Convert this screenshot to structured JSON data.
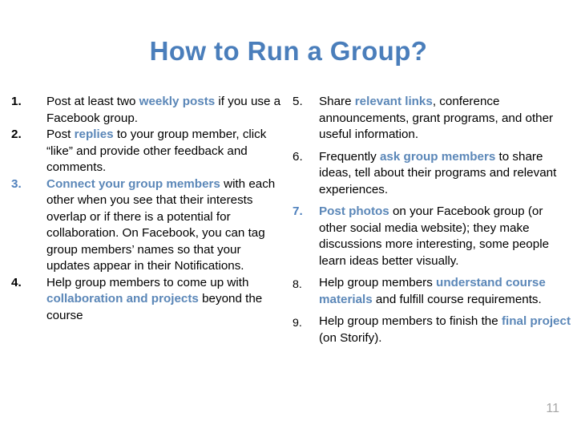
{
  "slide": {
    "title": "How to Run a Group?",
    "page_number": "11",
    "title_color": "#4a7ebb",
    "accent_color": "#5b87b8",
    "number_accent_color": "#4f81bd",
    "body_color": "#000000",
    "page_number_color": "#a6a6a6",
    "background_color": "#ffffff"
  },
  "columns": {
    "left": [
      {
        "number": "1.",
        "number_accent": false,
        "segments": [
          {
            "text": "Post at least two ",
            "highlight": false
          },
          {
            "text": "weekly posts",
            "highlight": true
          },
          {
            "text": " if you use a Facebook group.",
            "highlight": false
          }
        ]
      },
      {
        "number": "2.",
        "number_accent": false,
        "segments": [
          {
            "text": "Post ",
            "highlight": false
          },
          {
            "text": "replies",
            "highlight": true
          },
          {
            "text": " to your group member, click “like” and provide other feedback and comments.",
            "highlight": false
          }
        ]
      },
      {
        "number": "3.",
        "number_accent": true,
        "segments": [
          {
            "text": "Connect your group members",
            "highlight": true
          },
          {
            "text": " with each other when you see that their interests overlap or if there is a potential for collaboration. On Facebook, you can tag group members’ names so that your updates appear in their Notifications.",
            "highlight": false
          }
        ]
      },
      {
        "number": "4.",
        "number_accent": false,
        "segments": [
          {
            "text": "Help group members to come up with ",
            "highlight": false
          },
          {
            "text": "collaboration and projects",
            "highlight": true
          },
          {
            "text": " beyond the course",
            "highlight": false
          }
        ]
      }
    ],
    "right": [
      {
        "number": "5.",
        "number_accent": false,
        "number_shift": false,
        "segments": [
          {
            "text": "Share ",
            "highlight": false
          },
          {
            "text": "relevant links",
            "highlight": true
          },
          {
            "text": ", conference announcements, grant programs, and other useful information.",
            "highlight": false
          }
        ]
      },
      {
        "number": "6.",
        "number_accent": false,
        "number_shift": false,
        "segments": [
          {
            "text": "Frequently ",
            "highlight": false
          },
          {
            "text": "ask group members",
            "highlight": true
          },
          {
            "text": " to share ideas, tell about their programs and relevant experiences.",
            "highlight": false
          }
        ]
      },
      {
        "number": "7.",
        "number_accent": true,
        "number_shift": false,
        "segments": [
          {
            "text": "Post photos",
            "highlight": true
          },
          {
            "text": " on your Facebook group (or other social media website); they make discussions more interesting, some people learn ideas better visually.",
            "highlight": false
          }
        ]
      },
      {
        "number": "8.",
        "number_accent": false,
        "number_shift": true,
        "segments": [
          {
            "text": "Help group members ",
            "highlight": false
          },
          {
            "text": "understand course materials",
            "highlight": true
          },
          {
            "text": " and fulfill course requirements.",
            "highlight": false
          }
        ]
      },
      {
        "number": "9.",
        "number_accent": false,
        "number_shift": true,
        "segments": [
          {
            "text": "Help group members to finish the ",
            "highlight": false
          },
          {
            "text": "final project",
            "highlight": true
          },
          {
            "text": " (on Storify).",
            "highlight": false
          }
        ]
      }
    ]
  }
}
